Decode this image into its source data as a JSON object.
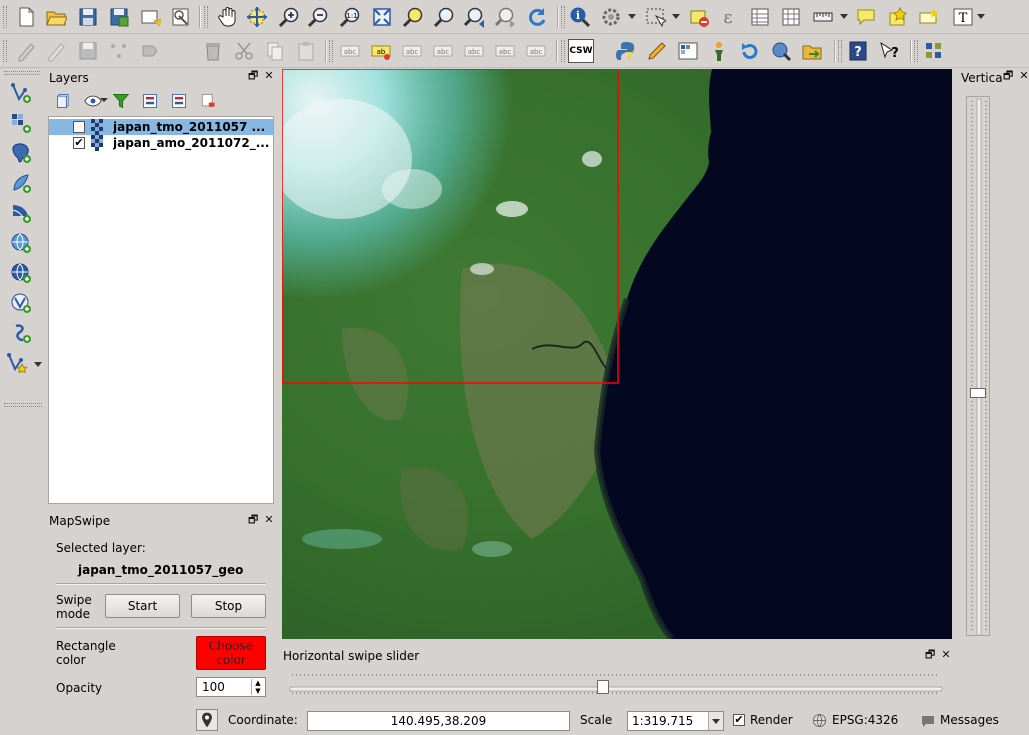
{
  "toolbar_top": {
    "icons": [
      "new-project-icon",
      "open-project-icon",
      "save-project-icon",
      "save-as-icon",
      "new-print-composer-icon",
      "composer-manager-icon",
      "pan-icon",
      "pan-to-selection-icon",
      "zoom-in-icon",
      "zoom-out-icon",
      "zoom-actual-icon",
      "zoom-full-icon",
      "zoom-to-selection-icon",
      "zoom-to-layer-icon",
      "zoom-last-icon",
      "zoom-next-icon",
      "refresh-icon",
      "identify-icon",
      "select-feature-icon",
      "select-by-rectangle-icon",
      "deselect-icon",
      "measure-line-icon",
      "attribute-table-icon",
      "statistics-icon",
      "measure-icon",
      "annotation-icon",
      "text-annotation-icon",
      "label-icon",
      "text-tool-icon"
    ]
  },
  "toolbar_second": {
    "icons": [
      "digitize-icon",
      "edit-pencil-icon",
      "save-edits-icon",
      "add-feature-icon",
      "move-feature-icon",
      "delete-icon",
      "cut-icon",
      "copy-icon",
      "paste-icon",
      "layer-labeling-icon",
      "label-pin-icon",
      "label-show-hide-icon",
      "label-move-icon",
      "label-rotate-icon",
      "label-change-icon",
      "csw-label",
      "python-console-icon",
      "digitize-pen-icon",
      "heatmap-icon",
      "person-icon",
      "rotate-icon",
      "geoprocessing-icon",
      "export-icon",
      "help-icon",
      "whats-this-icon",
      "plugin-icon"
    ],
    "csw": "CSW"
  },
  "layers_panel": {
    "title": "Layers",
    "layers": [
      {
        "name": "japan_tmo_2011057 ...",
        "checked": false,
        "selected": true
      },
      {
        "name": "japan_amo_2011072_...",
        "checked": true,
        "selected": false
      }
    ],
    "checked_mark": "✔"
  },
  "mapswipe_panel": {
    "title": "MapSwipe",
    "selected_layer_label": "Selected layer:",
    "selected_layer_value": "japan_tmo_2011057_geo",
    "swipe_mode_label": "Swipe mode",
    "start_button": "Start",
    "stop_button": "Stop",
    "rectangle_color_label": "Rectangle color",
    "choose_color_button": "Choose color",
    "rectangle_color": "#ff0000",
    "opacity_label": "Opacity",
    "opacity_value": "100"
  },
  "vertical_panel": {
    "title": "Vertica"
  },
  "horizontal_slider_panel": {
    "title": "Horizontal swipe slider",
    "slider_value": 0.48
  },
  "vertical_slider": {
    "slider_value": 0.55
  },
  "dock": {
    "float": "🗗",
    "close": "✕"
  },
  "status_bar": {
    "coordinate_label": "Coordinate:",
    "coordinate_value": "140.495,38.209",
    "scale_label": "Scale",
    "scale_value": "1:319.715",
    "render_label": "Render",
    "render_checked": true,
    "epsg_label": "EPSG:4326",
    "messages_label": "Messages"
  }
}
